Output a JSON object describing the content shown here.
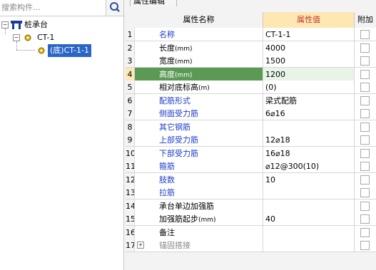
{
  "colors": {
    "blue_text": "#1d3cc8",
    "highlight_header": "#ffe7b3",
    "highlight_row": "#5b9a55",
    "selected_row_bg": "#2b66c6"
  },
  "sidebar": {
    "search_placeholder": "搜索构件...",
    "search_icon": "search-icon",
    "tree": {
      "root": "桩承台",
      "child": "CT-1",
      "leaf": "(底)CT-1-1"
    }
  },
  "panel": {
    "tab_label": "属性编辑",
    "headers": {
      "num": "",
      "name": "属性名称",
      "value": "属性值",
      "extra": "附加"
    },
    "rows": [
      {
        "num": "1",
        "name": "名称",
        "unit": "",
        "value": "CT-1-1",
        "name_blue": true
      },
      {
        "num": "2",
        "name": "长度",
        "unit": "(mm)",
        "value": "4000",
        "name_blue": false
      },
      {
        "num": "3",
        "name": "宽度",
        "unit": "(mm)",
        "value": "1500",
        "name_blue": false
      },
      {
        "num": "4",
        "name": "高度",
        "unit": "(mm)",
        "value": "1200",
        "name_blue": false,
        "selected": true
      },
      {
        "num": "5",
        "name": "相对底标高",
        "unit": "(m)",
        "value": "(0)",
        "name_blue": false
      },
      {
        "num": "6",
        "name": "配筋形式",
        "unit": "",
        "value": "梁式配筋",
        "name_blue": true
      },
      {
        "num": "7",
        "name": "侧面受力筋",
        "unit": "",
        "value": "6⌀16",
        "name_blue": true
      },
      {
        "num": "8",
        "name": "其它钢筋",
        "unit": "",
        "value": "",
        "name_blue": true
      },
      {
        "num": "9",
        "name": "上部受力筋",
        "unit": "",
        "value": "12⌀18",
        "name_blue": true
      },
      {
        "num": "10",
        "name": "下部受力筋",
        "unit": "",
        "value": "16⌀18",
        "name_blue": true
      },
      {
        "num": "11",
        "name": "箍筋",
        "unit": "",
        "value": "⌀12@300(10)",
        "name_blue": true
      },
      {
        "num": "12",
        "name": "肢数",
        "unit": "",
        "value": "10",
        "name_blue": true
      },
      {
        "num": "13",
        "name": "拉筋",
        "unit": "",
        "value": "",
        "name_blue": true
      },
      {
        "num": "14",
        "name": "承台单边加强筋",
        "unit": "",
        "value": "",
        "name_blue": false
      },
      {
        "num": "15",
        "name": "加强筋起步",
        "unit": "(mm)",
        "value": "40",
        "name_blue": false
      },
      {
        "num": "16",
        "name": "备注",
        "unit": "",
        "value": "",
        "name_blue": false
      },
      {
        "num": "17",
        "name": "锚固搭接",
        "unit": "",
        "value": "",
        "name_blue": false,
        "expandable": true
      }
    ]
  }
}
